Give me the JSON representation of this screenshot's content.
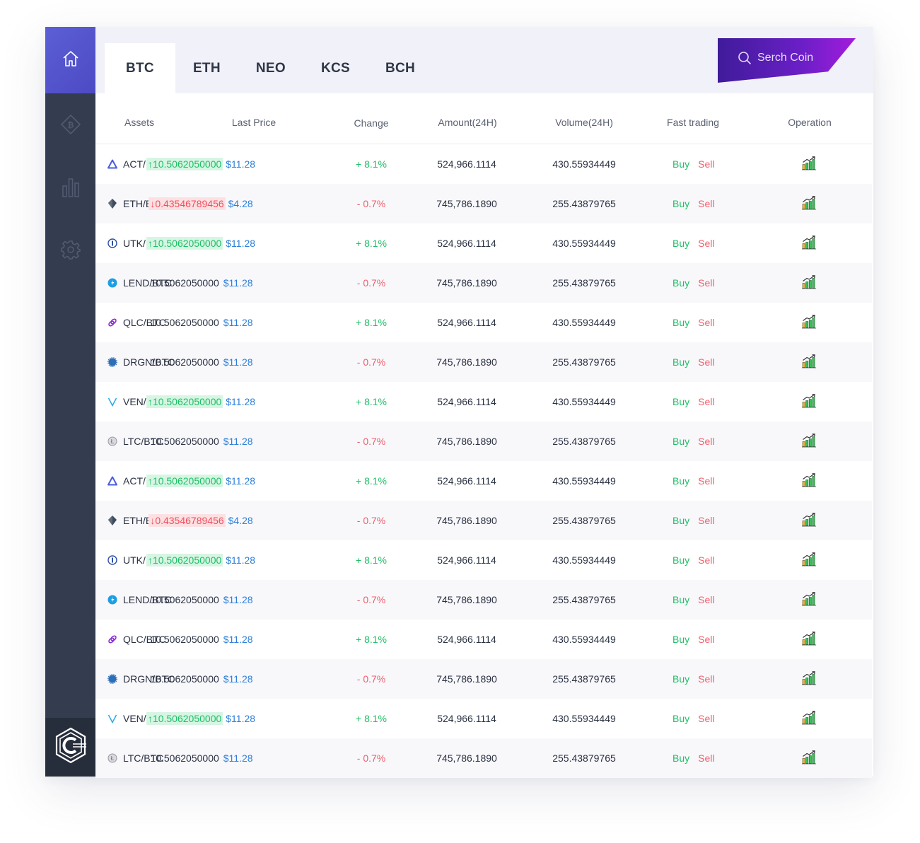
{
  "nav": {
    "items": [
      {
        "name": "home",
        "icon": "home-icon"
      },
      {
        "name": "coin",
        "icon": "bitcoin-diamond-icon"
      },
      {
        "name": "chart",
        "icon": "bar-chart-icon"
      },
      {
        "name": "settings",
        "icon": "gear-icon"
      }
    ],
    "logo_icon": "hexagon-c-logo-icon"
  },
  "header": {
    "tabs": [
      {
        "label": "BTC",
        "active": true
      },
      {
        "label": "ETH",
        "active": false
      },
      {
        "label": "NEO",
        "active": false
      },
      {
        "label": "KCS",
        "active": false
      },
      {
        "label": "BCH",
        "active": false
      }
    ],
    "search": {
      "label": "Serch Coin",
      "icon": "search-icon"
    }
  },
  "table": {
    "columns": [
      "Assets",
      "Last Price",
      "Change",
      "Amount(24H)",
      "Volume(24H)",
      "Fast trading",
      "Operation"
    ],
    "buy_label": "Buy",
    "sell_label": "Sell",
    "operation_icon": "trend-chart-icon",
    "rows": [
      {
        "asset": "ACT/BTC",
        "icon": "act-icon",
        "price": "↑10.5062050000",
        "trend": "up",
        "usd": "$11.28",
        "change": "+ 8.1%",
        "change_dir": "up",
        "amount": "524,966.1114",
        "volume": "430.55934449"
      },
      {
        "asset": "ETH/BTC",
        "icon": "eth-icon",
        "price": "↓0.43546789456",
        "trend": "down",
        "usd": "$4.28",
        "change": "- 0.7%",
        "change_dir": "down",
        "amount": "745,786.1890",
        "volume": "255.43879765"
      },
      {
        "asset": "UTK/BTC",
        "icon": "utk-icon",
        "price": "↑10.5062050000",
        "trend": "up",
        "usd": "$11.28",
        "change": "+ 8.1%",
        "change_dir": "up",
        "amount": "524,966.1114",
        "volume": "430.55934449"
      },
      {
        "asset": "LEND/BTC",
        "icon": "lend-icon",
        "price": "10.5062050000",
        "trend": "none",
        "usd": "$11.28",
        "change": "- 0.7%",
        "change_dir": "down",
        "amount": "745,786.1890",
        "volume": "255.43879765"
      },
      {
        "asset": "QLC/BTC",
        "icon": "qlc-icon",
        "price": "10.5062050000",
        "trend": "none",
        "usd": "$11.28",
        "change": "+ 8.1%",
        "change_dir": "up",
        "amount": "524,966.1114",
        "volume": "430.55934449"
      },
      {
        "asset": "DRGN/BTC",
        "icon": "drgn-icon",
        "price": "10.5062050000",
        "trend": "none",
        "usd": "$11.28",
        "change": "- 0.7%",
        "change_dir": "down",
        "amount": "745,786.1890",
        "volume": "255.43879765"
      },
      {
        "asset": "VEN/BTC",
        "icon": "ven-icon",
        "price": "↑10.5062050000",
        "trend": "up",
        "usd": "$11.28",
        "change": "+ 8.1%",
        "change_dir": "up",
        "amount": "524,966.1114",
        "volume": "430.55934449"
      },
      {
        "asset": "LTC/BTC",
        "icon": "ltc-icon",
        "price": "10.5062050000",
        "trend": "none",
        "usd": "$11.28",
        "change": "- 0.7%",
        "change_dir": "down",
        "amount": "745,786.1890",
        "volume": "255.43879765"
      },
      {
        "asset": "ACT/BTC",
        "icon": "act-icon",
        "price": "↑10.5062050000",
        "trend": "up",
        "usd": "$11.28",
        "change": "+ 8.1%",
        "change_dir": "up",
        "amount": "524,966.1114",
        "volume": "430.55934449"
      },
      {
        "asset": "ETH/BTC",
        "icon": "eth-icon",
        "price": "↓0.43546789456",
        "trend": "down",
        "usd": "$4.28",
        "change": "- 0.7%",
        "change_dir": "down",
        "amount": "745,786.1890",
        "volume": "255.43879765"
      },
      {
        "asset": "UTK/BTC",
        "icon": "utk-icon",
        "price": "↑10.5062050000",
        "trend": "up",
        "usd": "$11.28",
        "change": "+ 8.1%",
        "change_dir": "up",
        "amount": "524,966.1114",
        "volume": "430.55934449"
      },
      {
        "asset": "LEND/BTC",
        "icon": "lend-icon",
        "price": "10.5062050000",
        "trend": "none",
        "usd": "$11.28",
        "change": "- 0.7%",
        "change_dir": "down",
        "amount": "745,786.1890",
        "volume": "255.43879765"
      },
      {
        "asset": "QLC/BTC",
        "icon": "qlc-icon",
        "price": "10.5062050000",
        "trend": "none",
        "usd": "$11.28",
        "change": "+ 8.1%",
        "change_dir": "up",
        "amount": "524,966.1114",
        "volume": "430.55934449"
      },
      {
        "asset": "DRGN/BTC",
        "icon": "drgn-icon",
        "price": "10.5062050000",
        "trend": "none",
        "usd": "$11.28",
        "change": "- 0.7%",
        "change_dir": "down",
        "amount": "745,786.1890",
        "volume": "255.43879765"
      },
      {
        "asset": "VEN/BTC",
        "icon": "ven-icon",
        "price": "↑10.5062050000",
        "trend": "up",
        "usd": "$11.28",
        "change": "+ 8.1%",
        "change_dir": "up",
        "amount": "524,966.1114",
        "volume": "430.55934449"
      },
      {
        "asset": "LTC/BTC",
        "icon": "ltc-icon",
        "price": "10.5062050000",
        "trend": "none",
        "usd": "$11.28",
        "change": "- 0.7%",
        "change_dir": "down",
        "amount": "745,786.1890",
        "volume": "255.43879765"
      }
    ]
  },
  "colors": {
    "accent": "#5b5fd6",
    "sidebar": "#343c4f",
    "search_gradient_start": "#3f1b9a",
    "search_gradient_end": "#a21cdd",
    "up": "#1fbf66",
    "down": "#ef5e6b",
    "usd": "#2e7fd9"
  }
}
